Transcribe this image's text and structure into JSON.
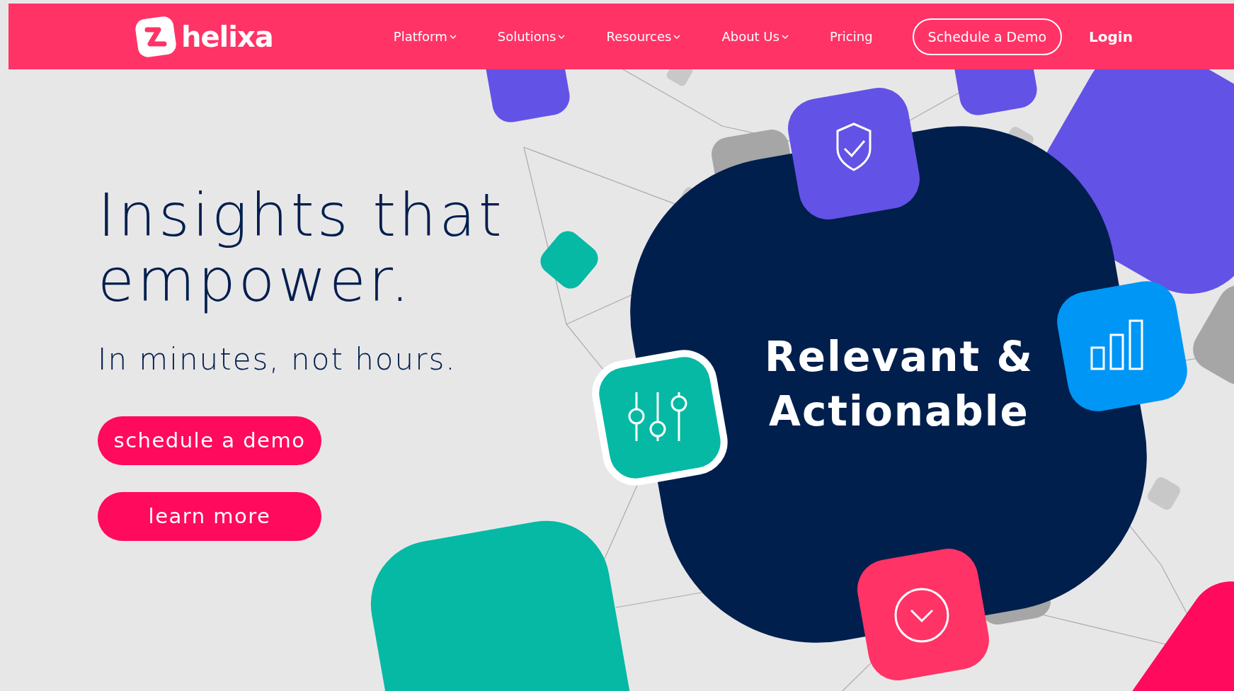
{
  "header": {
    "logo_text": "helixa",
    "nav": [
      {
        "label": "Platform",
        "dropdown": true
      },
      {
        "label": "Solutions",
        "dropdown": true
      },
      {
        "label": "Resources",
        "dropdown": true
      },
      {
        "label": "About Us",
        "dropdown": true
      },
      {
        "label": "Pricing",
        "dropdown": false
      }
    ],
    "cta": "Schedule a Demo",
    "login": "Login"
  },
  "hero": {
    "headline": "Insights that empower.",
    "subheadline": "In minutes, not hours.",
    "buttons": [
      "schedule a demo",
      "learn more"
    ],
    "badge_text": "Relevant & Actionable"
  }
}
